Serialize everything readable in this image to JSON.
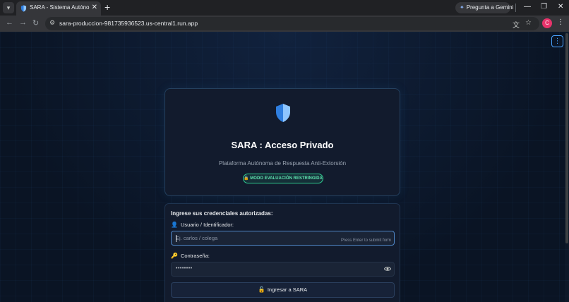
{
  "browser": {
    "tab_title": "SARA - Sistema Autónomo de",
    "tab_close": "✕",
    "new_tab": "+",
    "gemini_label": "Pregunta a Gemini",
    "url": "sara-produccion-981735936523.us-central1.run.app",
    "profile_initial": "C",
    "window_controls": {
      "minimize": "—",
      "restore": "❐",
      "close": "✕"
    }
  },
  "hero": {
    "title": "SARA : Acceso Privado",
    "subtitle": "Plataforma Autónoma de Respuesta Anti-Extorsión",
    "badge": "🔒 MODO EVALUACIÓN RESTRINGIDA",
    "shield_colors": {
      "left": "#2f7fe0",
      "right": "#8ec6ff"
    }
  },
  "form": {
    "heading": "Ingrese sus credenciales autorizadas:",
    "user_icon": "👤",
    "user_label": "Usuario / Identificador:",
    "user_placeholder": "Ej. carlos / colega",
    "enter_hint": "Press Enter to submit form",
    "pass_icon": "🔑",
    "pass_label": "Contraseña:",
    "pass_value": "••••••••",
    "submit_icon": "🔓",
    "submit_label": "Ingresar a SARA"
  },
  "colors": {
    "page_bg": "#0a1424",
    "card_bg": "#121b2d",
    "accent_green": "#2ec98f",
    "input_focus": "#4f86c6"
  }
}
